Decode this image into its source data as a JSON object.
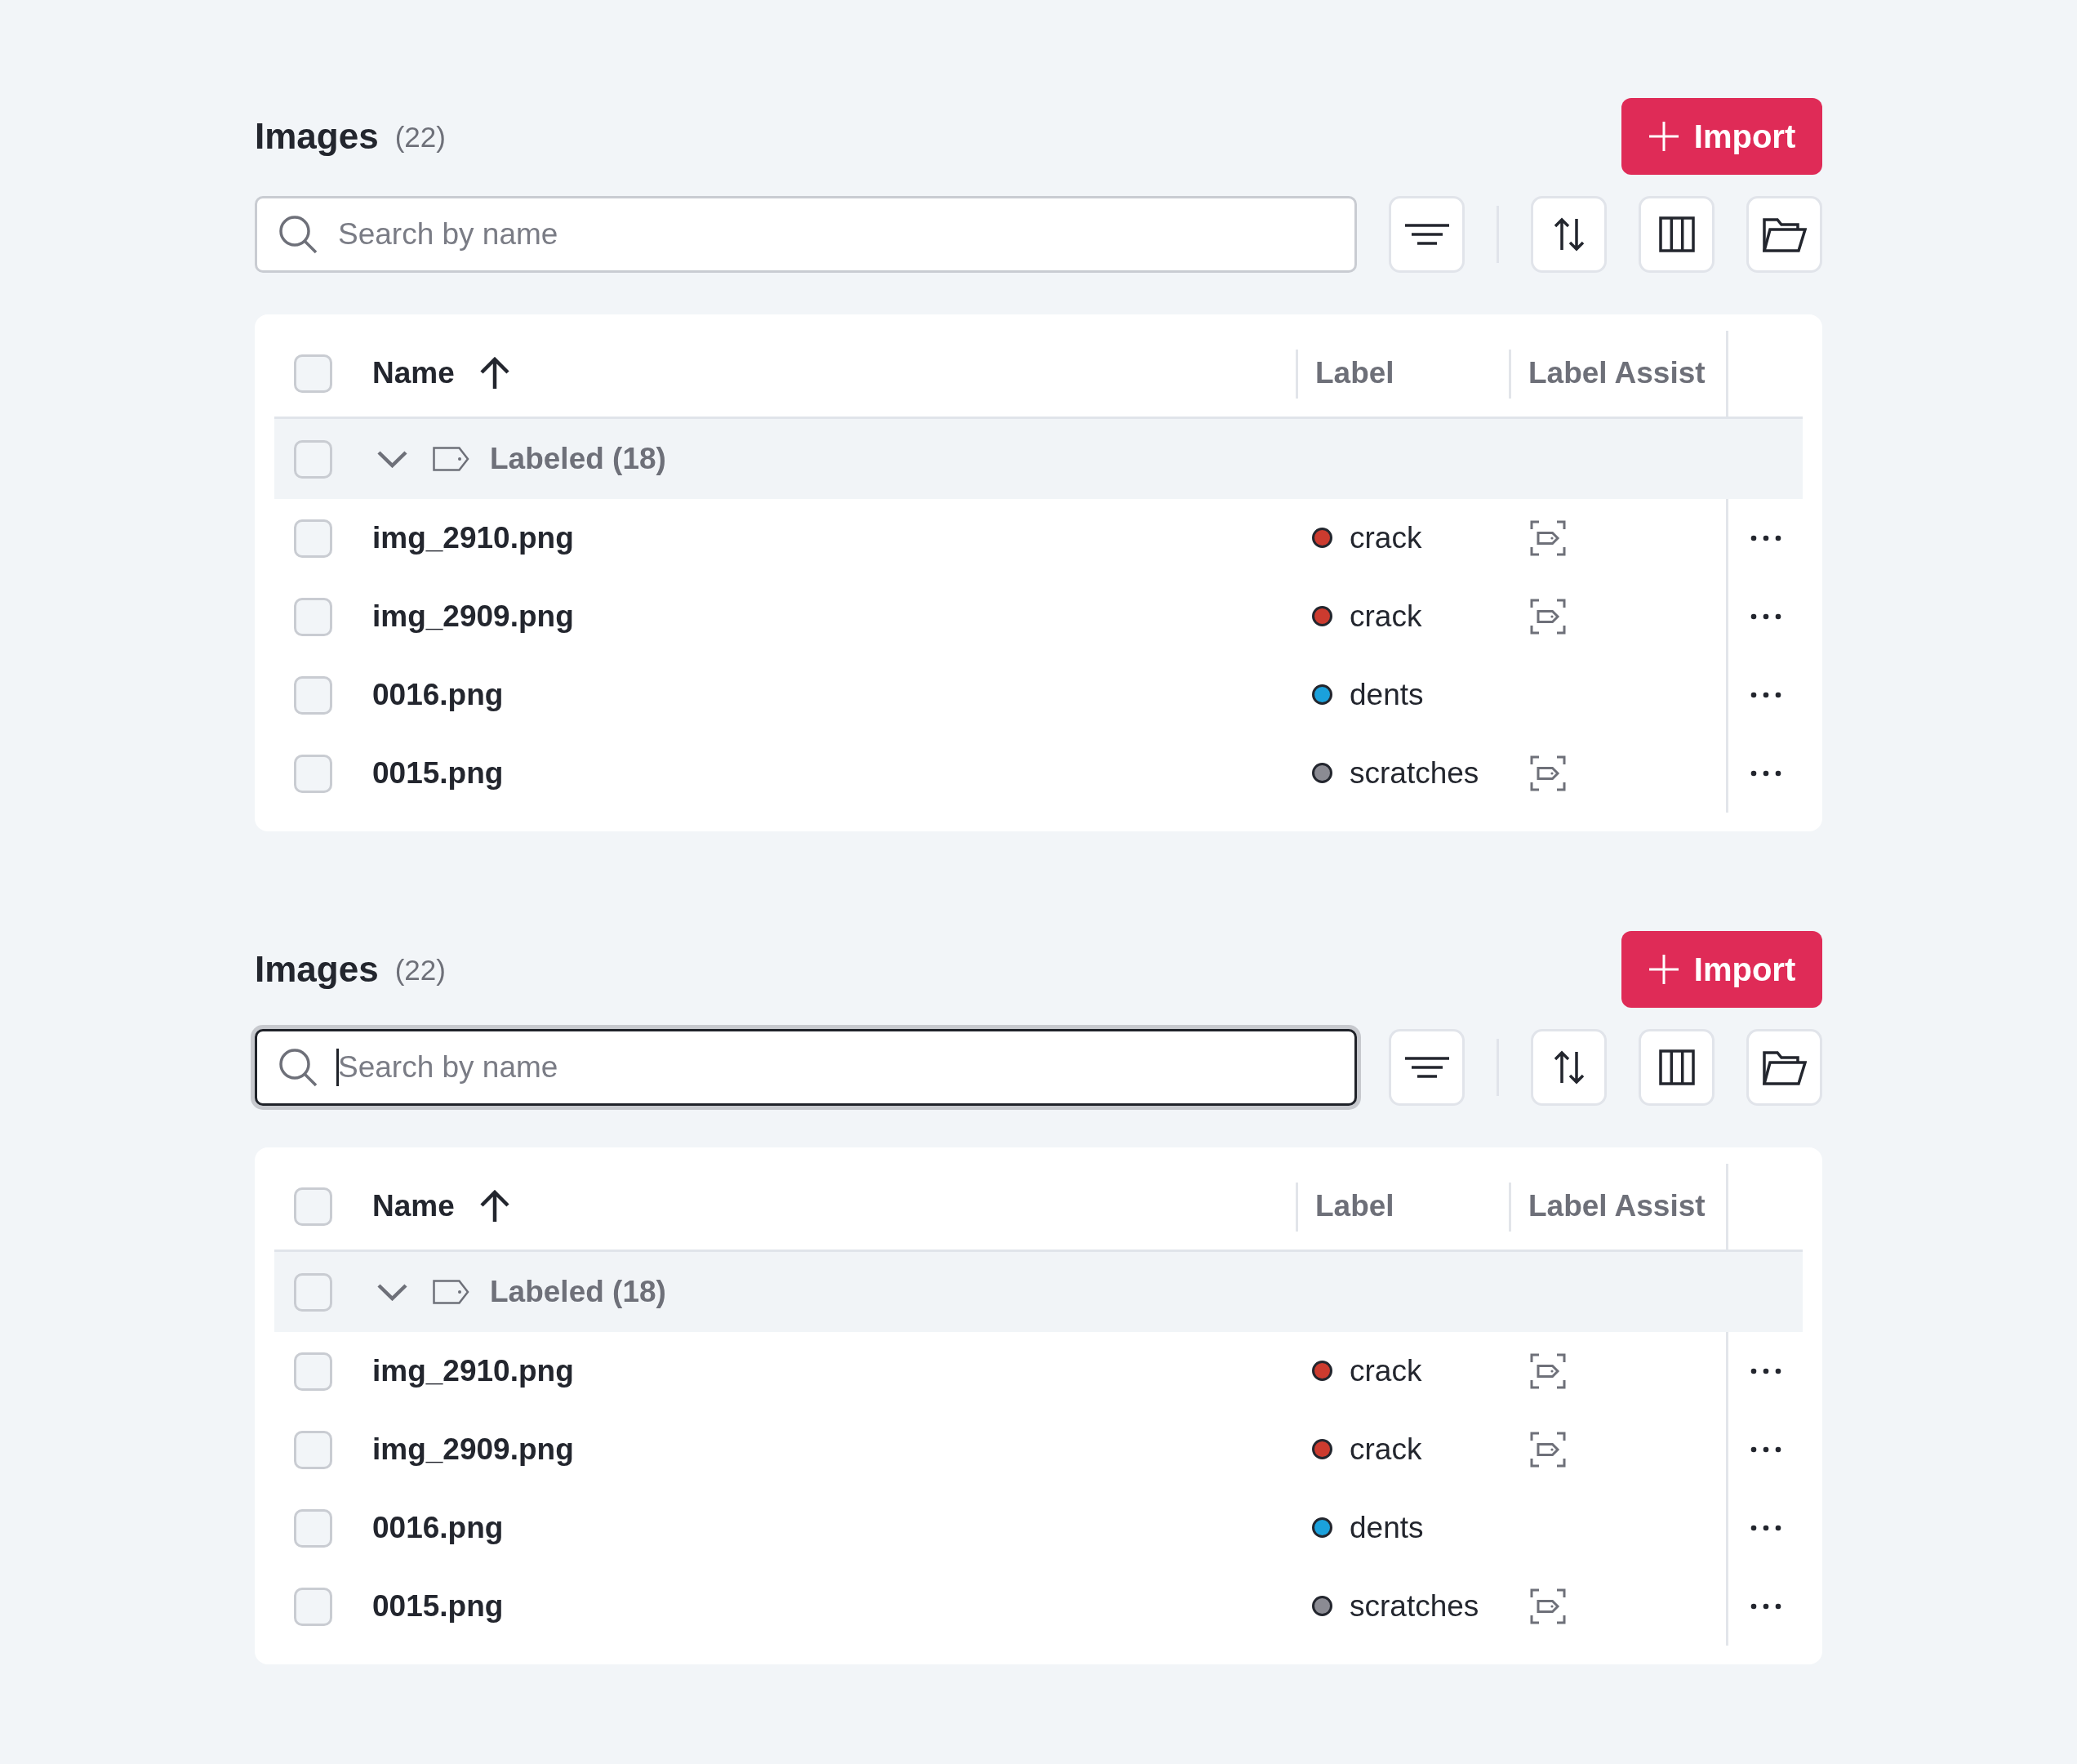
{
  "panels": [
    {
      "title": "Images",
      "count": "(22)",
      "import_label": "Import",
      "search": {
        "placeholder": "Search by name",
        "focused": false
      },
      "select_all": {
        "checked": false
      },
      "columns": [
        {
          "label": "Name",
          "sorted": true
        },
        {
          "label": "Label",
          "sorted": false
        },
        {
          "label": "Label Assist",
          "sorted": false
        }
      ],
      "group": {
        "label": "Labeled (18)",
        "checked": false,
        "expanded": true
      },
      "rows": [
        {
          "name": "img_2910.png",
          "checked": false,
          "label": "crack",
          "color": "#cc3b2f",
          "label_assist": true
        },
        {
          "name": "img_2909.png",
          "checked": false,
          "label": "crack",
          "color": "#cc3b2f",
          "label_assist": true
        },
        {
          "name": "0016.png",
          "checked": false,
          "label": "dents",
          "color": "#1ba1dc",
          "label_assist": false
        },
        {
          "name": "0015.png",
          "checked": false,
          "label": "scratches",
          "color": "#8b8b93",
          "label_assist": true
        }
      ]
    },
    {
      "title": "Images",
      "count": "(22)",
      "import_label": "Import",
      "search": {
        "placeholder": "Search by name",
        "focused": true
      },
      "select_all": {
        "checked": false
      },
      "columns": [
        {
          "label": "Name",
          "sorted": true
        },
        {
          "label": "Label",
          "sorted": false
        },
        {
          "label": "Label Assist",
          "sorted": false
        }
      ],
      "group": {
        "label": "Labeled (18)",
        "checked": false,
        "expanded": true
      },
      "rows": [
        {
          "name": "img_2910.png",
          "checked": false,
          "label": "crack",
          "color": "#cc3b2f",
          "label_assist": true
        },
        {
          "name": "img_2909.png",
          "checked": false,
          "label": "crack",
          "color": "#cc3b2f",
          "label_assist": true
        },
        {
          "name": "0016.png",
          "checked": false,
          "label": "dents",
          "color": "#1ba1dc",
          "label_assist": false
        },
        {
          "name": "0015.png",
          "checked": false,
          "label": "scratches",
          "color": "#8b8b93",
          "label_assist": true
        }
      ]
    }
  ]
}
